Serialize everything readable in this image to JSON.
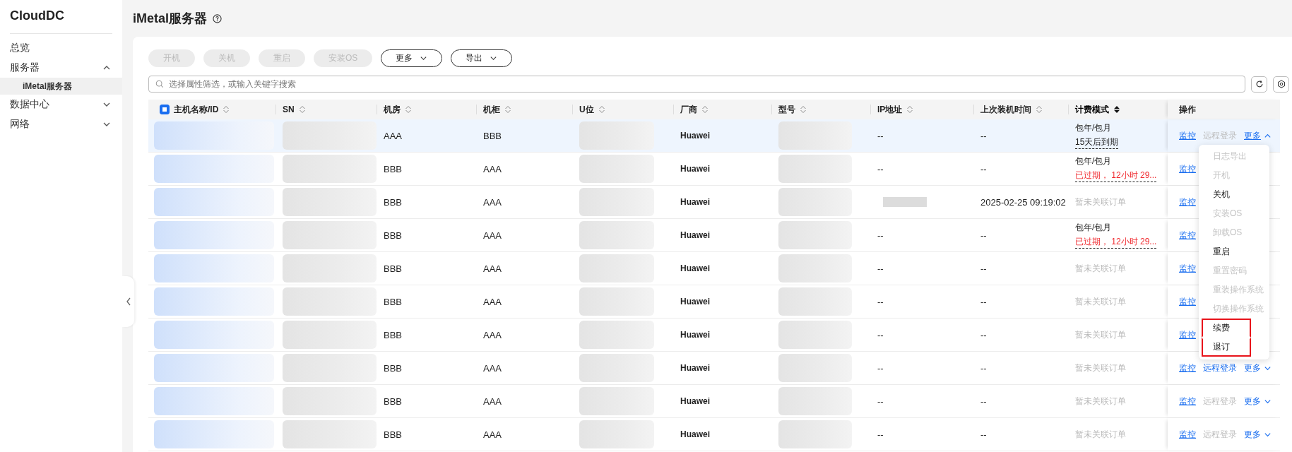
{
  "sidebar": {
    "brand": "CloudDC",
    "items": [
      {
        "label": "总览",
        "kind": "leaf",
        "selected": false
      },
      {
        "label": "服务器",
        "kind": "group",
        "expanded": true,
        "selected": false,
        "children": [
          {
            "label": "iMetal服务器",
            "kind": "leaf",
            "selected": true
          }
        ]
      },
      {
        "label": "数据中心",
        "kind": "group",
        "expanded": false,
        "selected": false
      },
      {
        "label": "网络",
        "kind": "group",
        "expanded": false,
        "selected": false
      }
    ]
  },
  "page": {
    "title": "iMetal服务器"
  },
  "toolbar": {
    "buttons": [
      {
        "label": "开机",
        "kind": "plain",
        "disabled": true
      },
      {
        "label": "关机",
        "kind": "plain",
        "disabled": true
      },
      {
        "label": "重启",
        "kind": "plain",
        "disabled": true
      },
      {
        "label": "安装OS",
        "kind": "plain",
        "disabled": true
      },
      {
        "label": "更多",
        "kind": "dropdown",
        "disabled": false
      },
      {
        "label": "导出",
        "kind": "dropdown",
        "disabled": false
      }
    ]
  },
  "search": {
    "placeholder": "选择属性筛选，或输入关键字搜索"
  },
  "table": {
    "select_all_indeterminate": true,
    "columns": [
      {
        "label": "主机名称/ID",
        "sortable": true,
        "sorted": false
      },
      {
        "label": "SN",
        "sortable": true,
        "sorted": false
      },
      {
        "label": "机房",
        "sortable": true,
        "sorted": false
      },
      {
        "label": "机柜",
        "sortable": true,
        "sorted": false
      },
      {
        "label": "U位",
        "sortable": true,
        "sorted": false
      },
      {
        "label": "厂商",
        "sortable": true,
        "sorted": false
      },
      {
        "label": "型号",
        "sortable": true,
        "sorted": false
      },
      {
        "label": "IP地址",
        "sortable": true,
        "sorted": false
      },
      {
        "label": "上次装机时间",
        "sortable": true,
        "sorted": false
      },
      {
        "label": "计费模式",
        "sortable": true,
        "sorted": true
      },
      {
        "label": "操作",
        "sortable": false,
        "sorted": false
      }
    ],
    "rows": [
      {
        "highlighted": true,
        "room": "AAA",
        "cabinet": "BBB",
        "vendor": "Huawei",
        "ip": "--",
        "ip_redacted": false,
        "installed": "--",
        "billing": {
          "kind": "subscription",
          "mode": "包年/包月",
          "status": "15天后到期",
          "expired": false
        },
        "actions": [
          {
            "label": "监控",
            "kind": "link",
            "disabled": false
          },
          {
            "label": "远程登录",
            "kind": "link",
            "disabled": true
          },
          {
            "label": "更多",
            "kind": "more",
            "expanded": true
          }
        ]
      },
      {
        "highlighted": false,
        "room": "BBB",
        "cabinet": "AAA",
        "vendor": "Huawei",
        "ip": "--",
        "ip_redacted": false,
        "installed": "--",
        "billing": {
          "kind": "subscription",
          "mode": "包年/包月",
          "status": "已过期， 12小时 29...",
          "expired": true
        },
        "actions": [
          {
            "label": "监控",
            "kind": "link",
            "disabled": false
          }
        ]
      },
      {
        "highlighted": false,
        "room": "BBB",
        "cabinet": "AAA",
        "vendor": "Huawei",
        "ip": "",
        "ip_redacted": true,
        "installed": "2025-02-25 09:19:02",
        "billing": {
          "kind": "none",
          "text": "暂未关联订单"
        },
        "actions": [
          {
            "label": "监控",
            "kind": "link",
            "disabled": false
          }
        ]
      },
      {
        "highlighted": false,
        "room": "BBB",
        "cabinet": "AAA",
        "vendor": "Huawei",
        "ip": "--",
        "ip_redacted": false,
        "installed": "--",
        "billing": {
          "kind": "subscription",
          "mode": "包年/包月",
          "status": "已过期， 12小时 29...",
          "expired": true
        },
        "actions": [
          {
            "label": "监控",
            "kind": "link",
            "disabled": false
          }
        ]
      },
      {
        "highlighted": false,
        "room": "BBB",
        "cabinet": "AAA",
        "vendor": "Huawei",
        "ip": "--",
        "ip_redacted": false,
        "installed": "--",
        "billing": {
          "kind": "none",
          "text": "暂未关联订单"
        },
        "actions": [
          {
            "label": "监控",
            "kind": "link",
            "disabled": false
          }
        ]
      },
      {
        "highlighted": false,
        "room": "BBB",
        "cabinet": "AAA",
        "vendor": "Huawei",
        "ip": "--",
        "ip_redacted": false,
        "installed": "--",
        "billing": {
          "kind": "none",
          "text": "暂未关联订单"
        },
        "actions": [
          {
            "label": "监控",
            "kind": "link",
            "disabled": false
          }
        ]
      },
      {
        "highlighted": false,
        "room": "BBB",
        "cabinet": "AAA",
        "vendor": "Huawei",
        "ip": "--",
        "ip_redacted": false,
        "installed": "--",
        "billing": {
          "kind": "none",
          "text": "暂未关联订单"
        },
        "actions": [
          {
            "label": "监控",
            "kind": "link",
            "disabled": false
          }
        ]
      },
      {
        "highlighted": false,
        "room": "BBB",
        "cabinet": "AAA",
        "vendor": "Huawei",
        "ip": "--",
        "ip_redacted": false,
        "installed": "--",
        "billing": {
          "kind": "none",
          "text": "暂未关联订单"
        },
        "actions": [
          {
            "label": "监控",
            "kind": "link",
            "disabled": false
          },
          {
            "label": "远程登录",
            "kind": "link",
            "disabled": false
          },
          {
            "label": "更多",
            "kind": "more",
            "expanded": false
          }
        ]
      },
      {
        "highlighted": false,
        "room": "BBB",
        "cabinet": "AAA",
        "vendor": "Huawei",
        "ip": "--",
        "ip_redacted": false,
        "installed": "--",
        "billing": {
          "kind": "none",
          "text": "暂未关联订单"
        },
        "actions": [
          {
            "label": "监控",
            "kind": "link",
            "disabled": false
          },
          {
            "label": "远程登录",
            "kind": "link",
            "disabled": true
          },
          {
            "label": "更多",
            "kind": "more",
            "expanded": false
          }
        ]
      },
      {
        "highlighted": false,
        "room": "BBB",
        "cabinet": "AAA",
        "vendor": "Huawei",
        "ip": "--",
        "ip_redacted": false,
        "installed": "--",
        "billing": {
          "kind": "none",
          "text": "暂未关联订单"
        },
        "actions": [
          {
            "label": "监控",
            "kind": "link",
            "disabled": false
          },
          {
            "label": "远程登录",
            "kind": "link",
            "disabled": true
          },
          {
            "label": "更多",
            "kind": "more",
            "expanded": false
          }
        ]
      }
    ],
    "more_menu": [
      {
        "label": "日志导出",
        "disabled": true,
        "highlighted": false
      },
      {
        "label": "开机",
        "disabled": true,
        "highlighted": false
      },
      {
        "label": "关机",
        "disabled": false,
        "highlighted": false
      },
      {
        "label": "安装OS",
        "disabled": true,
        "highlighted": false
      },
      {
        "label": "卸载OS",
        "disabled": true,
        "highlighted": false
      },
      {
        "label": "重启",
        "disabled": false,
        "highlighted": false
      },
      {
        "label": "重置密码",
        "disabled": true,
        "highlighted": false
      },
      {
        "label": "重装操作系统",
        "disabled": true,
        "highlighted": false
      },
      {
        "label": "切换操作系统",
        "disabled": true,
        "highlighted": false
      },
      {
        "label": "续费",
        "disabled": false,
        "highlighted": true
      },
      {
        "label": "退订",
        "disabled": false,
        "highlighted": true
      }
    ]
  }
}
